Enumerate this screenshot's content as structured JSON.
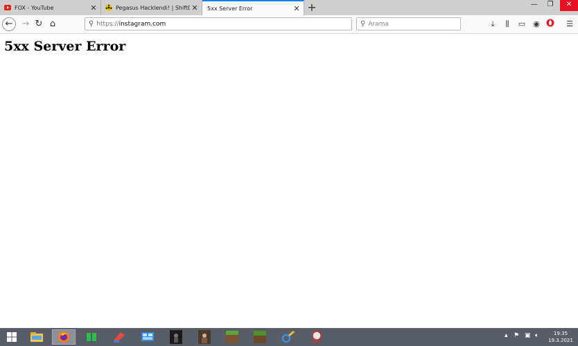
{
  "tabs": [
    {
      "title": "FOX - YouTube",
      "icon": "youtube-icon"
    },
    {
      "title": "Pegasus Hacklendi! | ShiftDelete",
      "icon": "hazard-icon"
    },
    {
      "title": "5xx Server Error",
      "icon": "none"
    }
  ],
  "toolbar": {
    "url_protocol": "https://",
    "url_host": "instagram.com",
    "search_placeholder": "Arama"
  },
  "page": {
    "heading": "5xx Server Error"
  },
  "taskbar": {
    "apps": [
      "windows-start",
      "file-explorer",
      "firefox",
      "green-app",
      "paint-app",
      "control-panel",
      "game-app-1",
      "game-app-2",
      "minecraft-1",
      "minecraft-2",
      "tools-app",
      "network-app"
    ],
    "time": "19:35",
    "date": "19.3.2021"
  },
  "colors": {
    "accent": "#0a84ff",
    "taskbar": "#595d66",
    "close": "#e81123"
  }
}
